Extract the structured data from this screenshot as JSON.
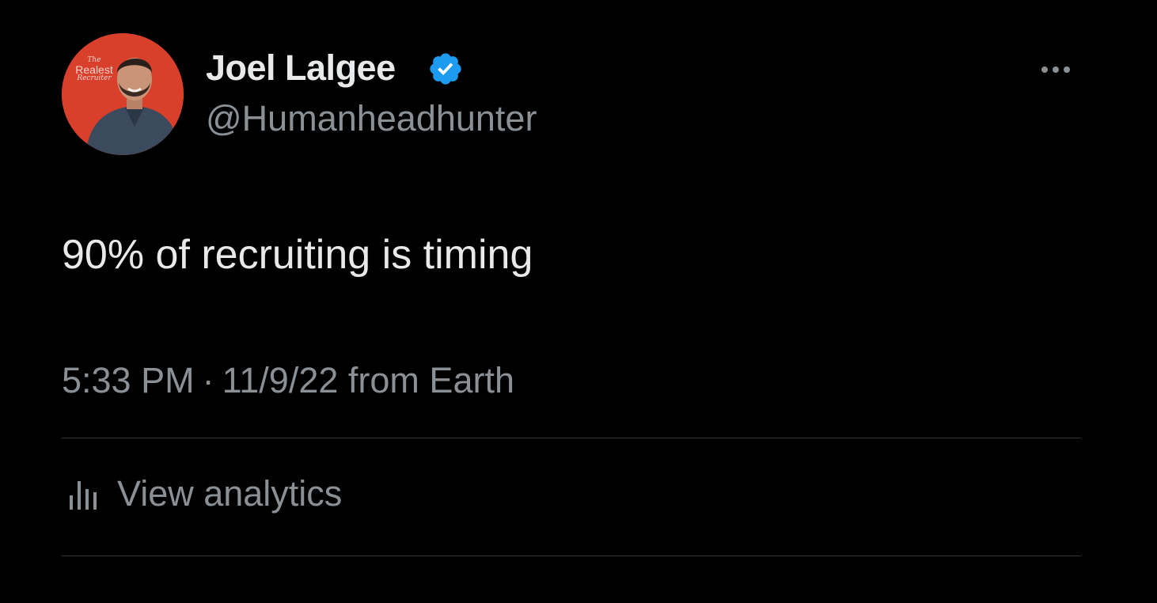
{
  "author": {
    "display_name": "Joel Lalgee",
    "handle": "@Humanheadhunter",
    "verified_icon": "verified-badge-icon",
    "avatar": {
      "badge_line1": "The",
      "badge_line2": "Realest",
      "badge_line3": "Recruiter",
      "background_color": "#d9402b"
    }
  },
  "tweet": {
    "text": "90% of recruiting is timing",
    "time": "5:33 PM",
    "separator": "·",
    "date": "11/9/22",
    "source": "from Earth"
  },
  "actions": {
    "more_icon": "more-horizontal-icon",
    "analytics_icon": "bar-chart-icon",
    "analytics_label": "View analytics"
  },
  "colors": {
    "background": "#000000",
    "primary_text": "#e7e9ea",
    "secondary_text": "#8b9095",
    "verified_blue": "#1d9bf0",
    "divider": "#2f3336"
  }
}
